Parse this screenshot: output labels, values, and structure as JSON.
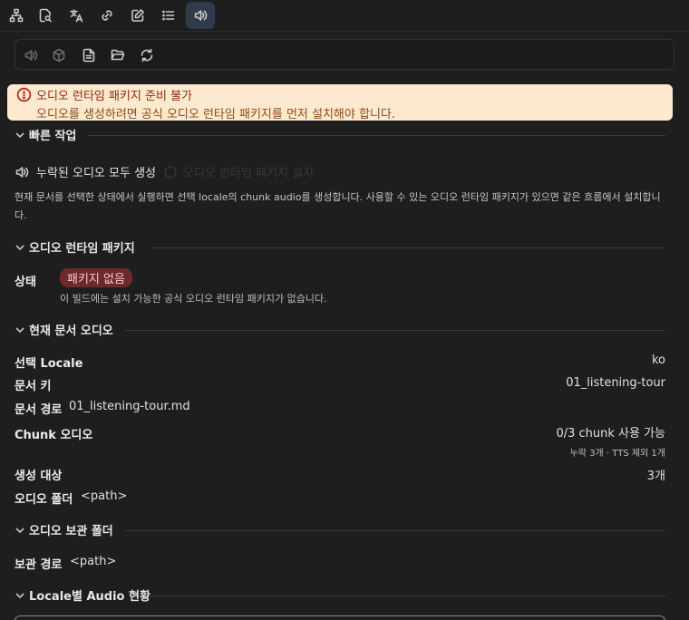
{
  "toolbar": {
    "tabs": [
      {
        "icon": "sitemap-icon"
      },
      {
        "icon": "file-search-icon"
      },
      {
        "icon": "translate-icon"
      },
      {
        "icon": "link-icon"
      },
      {
        "icon": "edit-icon"
      },
      {
        "icon": "list-icon"
      },
      {
        "icon": "speaker-icon",
        "active": true
      }
    ]
  },
  "subtoolbar": {
    "icons": [
      "speaker-icon",
      "cube-icon",
      "document-icon",
      "folder-open-icon",
      "refresh-icon"
    ]
  },
  "alert": {
    "title": "오디오 런타임 패키지 준비 불가",
    "body": "오디오를 생성하려면 공식 오디오 런타임 패키지를 먼저 설치해야 합니다.",
    "color": "#fde9cf"
  },
  "quick_actions": {
    "title": "빠른 작업",
    "generate_label": "누락된 오디오 모두 생성",
    "disabled_label": "오디오 런타임 패키지 설치",
    "description": "현재 문서를 선택한 상태에서 실행하면 선택 locale의 chunk audio를 생성합니다. 사용할 수 있는 오디오 런타임 패키지가 있으면 같은 흐름에서 설치합니다."
  },
  "runtime_package": {
    "title": "오디오 런타임 패키지",
    "status_label": "상태",
    "status_badge": "패키지 없음",
    "status_note": "이 빌드에는 설치 가능한 공식 오디오 런타임 패키지가 없습니다.",
    "badge_color": "#6e2a2a"
  },
  "doc_audio": {
    "title": "현재 문서 오디오",
    "locale_label": "선택 Locale",
    "locale_value": "ko",
    "key_label": "문서 키",
    "key_value": "01_listening-tour",
    "path_label": "문서 경로",
    "path_value": "01_listening-tour.md",
    "chunk_label": "Chunk 오디오",
    "chunk_value": "0/3 chunk 사용 가능",
    "chunk_note": "누락 3개 · TTS 제외 1개",
    "target_label": "생성 대상",
    "target_value": "3개",
    "folder_label": "오디오 폴더",
    "folder_value": "<path>"
  },
  "archive": {
    "title": "오디오 보관 폴더",
    "path_label": "보관 경로",
    "path_value": "<path>"
  },
  "locale_status": {
    "title": "Locale별 Audio 현황"
  }
}
